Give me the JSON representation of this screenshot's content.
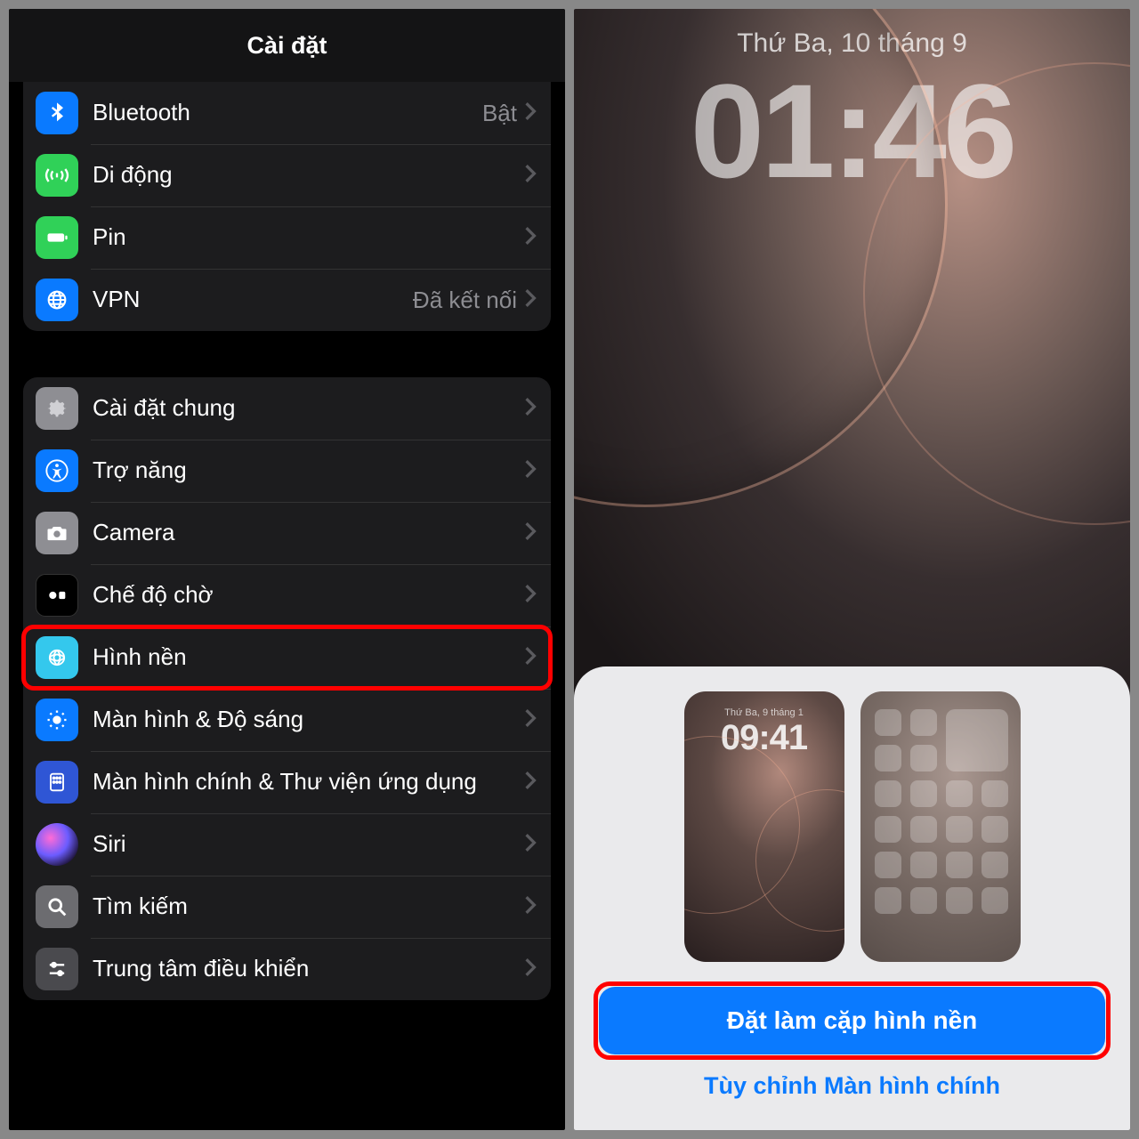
{
  "settings": {
    "title": "Cài đặt",
    "group1": [
      {
        "icon": "bluetooth",
        "bg": "#0a7aff",
        "label": "Bluetooth",
        "value": "Bật"
      },
      {
        "icon": "cellular",
        "bg": "#30d158",
        "label": "Di động",
        "value": ""
      },
      {
        "icon": "battery",
        "bg": "#30d158",
        "label": "Pin",
        "value": ""
      },
      {
        "icon": "vpn",
        "bg": "#0a7aff",
        "label": "VPN",
        "value": "Đã kết nối"
      }
    ],
    "group2": [
      {
        "icon": "gear",
        "bg": "#8e8e93",
        "label": "Cài đặt chung"
      },
      {
        "icon": "accessibility",
        "bg": "#0a7aff",
        "label": "Trợ năng"
      },
      {
        "icon": "camera",
        "bg": "#8e8e93",
        "label": "Camera"
      },
      {
        "icon": "standby",
        "bg": "#000000",
        "label": "Chế độ chờ"
      },
      {
        "icon": "wallpaper",
        "bg": "#34c8ed",
        "label": "Hình nền",
        "highlight": true
      },
      {
        "icon": "brightness",
        "bg": "#0a7aff",
        "label": "Màn hình & Độ sáng"
      },
      {
        "icon": "homescreen",
        "bg": "#2f56d5",
        "label": "Màn hình chính & Thư viện ứng dụng"
      },
      {
        "icon": "siri",
        "bg": "siri",
        "label": "Siri"
      },
      {
        "icon": "search",
        "bg": "#6c6c70",
        "label": "Tìm kiếm"
      },
      {
        "icon": "control",
        "bg": "#4a4a4e",
        "label": "Trung tâm điều khiển"
      }
    ]
  },
  "lockscreen": {
    "date": "Thứ Ba, 10 tháng 9",
    "time": "01:46",
    "preview_date": "Thứ Ba, 9 tháng 1",
    "preview_time": "09:41",
    "primary_button": "Đặt làm cặp hình nền",
    "secondary_button": "Tùy chỉnh Màn hình chính"
  }
}
